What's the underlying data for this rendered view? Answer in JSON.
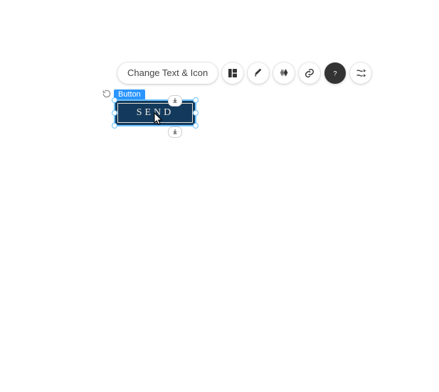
{
  "toolbar": {
    "change_text_label": "Change Text & Icon",
    "icons": {
      "layout": "layout-icon",
      "design": "paintbrush-icon",
      "animation": "animation-icon",
      "link": "link-icon",
      "help": "help-icon",
      "stretch": "stretch-icon"
    }
  },
  "selection": {
    "tag_label": "Button",
    "button_text": "SEND",
    "colors": {
      "bg": "#133a5d",
      "inner_border": "#e8e1d4",
      "text": "#f3ecdf",
      "selection": "#6ec1ff",
      "tag_bg": "#2a95ff"
    }
  }
}
